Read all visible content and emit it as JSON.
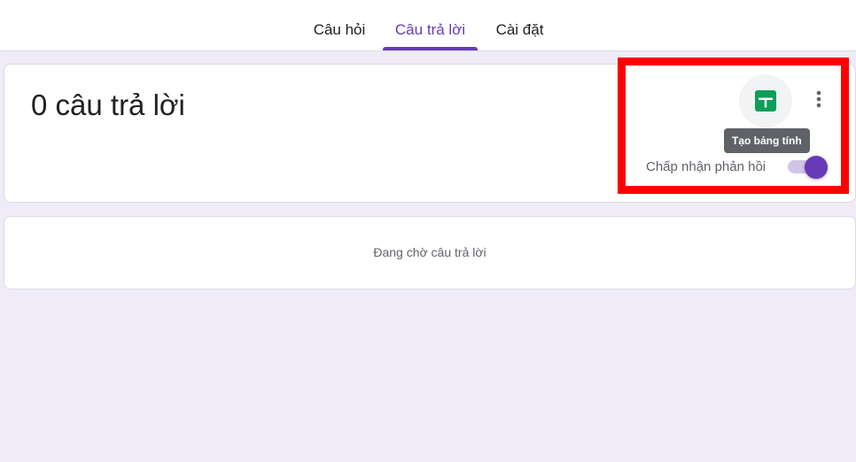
{
  "tabs": [
    {
      "label": "Câu hỏi",
      "active": false
    },
    {
      "label": "Câu trả lời",
      "active": true
    },
    {
      "label": "Cài đặt",
      "active": false
    }
  ],
  "summary": {
    "title": "0 câu trả lời",
    "create_sheet_icon": "google-sheets-icon",
    "more_icon": "more-vert-icon",
    "tooltip": "Tạo bảng tính",
    "accept_label": "Chấp nhận phản hồi",
    "accepting_responses": true
  },
  "empty_state": {
    "text": "Đang chờ câu trả lời"
  },
  "colors": {
    "accent": "#673ab7",
    "toggle_track": "#d1c4e9",
    "background": "#f0ebf8",
    "sheets_green": "#0f9d58",
    "highlight": "#ff0000"
  }
}
